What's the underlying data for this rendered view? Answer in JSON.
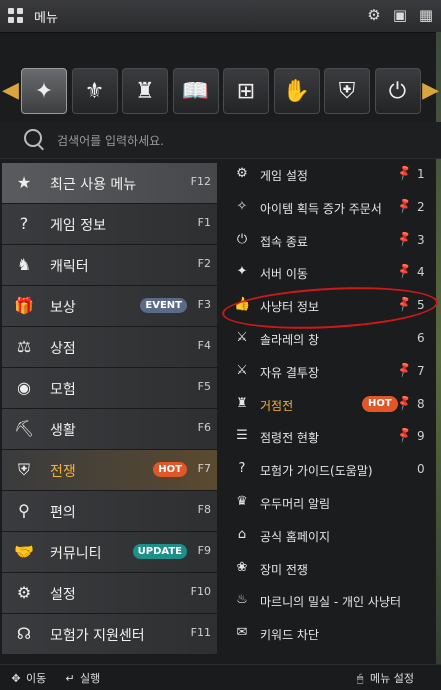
{
  "window": {
    "title": "메뉴"
  },
  "titlebar_icons": [
    "gear-icon",
    "window-icon",
    "grid-icon"
  ],
  "search": {
    "placeholder": "검색어를 입력하세요."
  },
  "categories": [
    {
      "name": "compass-icon",
      "glyph": "✦",
      "active": true
    },
    {
      "name": "eagle-crest-icon",
      "glyph": "⚜",
      "active": false
    },
    {
      "name": "tower-icon",
      "glyph": "♜",
      "active": false
    },
    {
      "name": "book-icon",
      "glyph": "📖",
      "active": false
    },
    {
      "name": "cross-box-icon",
      "glyph": "⊞",
      "active": false
    },
    {
      "name": "hand-wave-icon",
      "glyph": "✋",
      "active": false
    },
    {
      "name": "shield-sword-icon",
      "glyph": "⛨",
      "active": false
    },
    {
      "name": "power-icon",
      "glyph": "⏻",
      "active": false
    }
  ],
  "left_menu": [
    {
      "label": "최근 사용 메뉴",
      "key": "F12",
      "icon": "bookmark-star-icon",
      "glyph": "★",
      "badge": ""
    },
    {
      "label": "게임 정보",
      "key": "F1",
      "icon": "question-icon",
      "glyph": "?",
      "badge": ""
    },
    {
      "label": "캐릭터",
      "key": "F2",
      "icon": "helmet-icon",
      "glyph": "♞",
      "badge": ""
    },
    {
      "label": "보상",
      "key": "F3",
      "icon": "gift-icon",
      "glyph": "🎁",
      "badge": "EVENT"
    },
    {
      "label": "상점",
      "key": "F4",
      "icon": "shop-icon",
      "glyph": "⚖",
      "badge": ""
    },
    {
      "label": "모험",
      "key": "F5",
      "icon": "globe-icon",
      "glyph": "◉",
      "badge": ""
    },
    {
      "label": "생활",
      "key": "F6",
      "icon": "pickaxe-icon",
      "glyph": "⛏",
      "badge": ""
    },
    {
      "label": "전쟁",
      "key": "F7",
      "icon": "war-shield-icon",
      "glyph": "⛨",
      "badge": "HOT"
    },
    {
      "label": "편의",
      "key": "F8",
      "icon": "magnifier-icon",
      "glyph": "⚲",
      "badge": ""
    },
    {
      "label": "커뮤니티",
      "key": "F9",
      "icon": "handshake-icon",
      "glyph": "🤝",
      "badge": "UPDATE"
    },
    {
      "label": "설정",
      "key": "F10",
      "icon": "settings-icon",
      "glyph": "⚙",
      "badge": ""
    },
    {
      "label": "모험가 지원센터",
      "key": "F11",
      "icon": "headset-icon",
      "glyph": "☊",
      "badge": ""
    }
  ],
  "right_menu": [
    {
      "label": "게임 설정",
      "icon": "gear-icon",
      "glyph": "⚙",
      "pinned": true,
      "num": "1",
      "badge": ""
    },
    {
      "label": "아이템 획득 증가 주문서",
      "icon": "scroll-icon",
      "glyph": "✧",
      "pinned": true,
      "num": "2",
      "badge": ""
    },
    {
      "label": "접속 종료",
      "icon": "power-icon",
      "glyph": "⏻",
      "pinned": true,
      "num": "3",
      "badge": ""
    },
    {
      "label": "서버 이동",
      "icon": "compass-icon",
      "glyph": "✦",
      "pinned": true,
      "num": "4",
      "badge": ""
    },
    {
      "label": "사냥터 정보",
      "icon": "thumb-icon",
      "glyph": "👍",
      "pinned": true,
      "num": "5",
      "badge": ""
    },
    {
      "label": "솔라레의 창",
      "icon": "spear-icon",
      "glyph": "⚔",
      "pinned": false,
      "num": "6",
      "badge": ""
    },
    {
      "label": "자유 결투장",
      "icon": "crossed-swords-icon",
      "glyph": "⚔",
      "pinned": true,
      "num": "7",
      "badge": ""
    },
    {
      "label": "거점전",
      "icon": "tower-icon",
      "glyph": "♜",
      "pinned": true,
      "num": "8",
      "badge": "HOT"
    },
    {
      "label": "점령전 현황",
      "icon": "list-icon",
      "glyph": "☰",
      "pinned": true,
      "num": "9",
      "badge": ""
    },
    {
      "label": "모험가 가이드(도움말)",
      "icon": "question-icon",
      "glyph": "?",
      "pinned": false,
      "num": "0",
      "badge": ""
    },
    {
      "label": "우두머리 알림",
      "icon": "dragon-icon",
      "glyph": "♛",
      "pinned": false,
      "num": "",
      "badge": ""
    },
    {
      "label": "공식 홈페이지",
      "icon": "home-icon",
      "glyph": "⌂",
      "pinned": false,
      "num": "",
      "badge": ""
    },
    {
      "label": "장미 전쟁",
      "icon": "rose-icon",
      "glyph": "❀",
      "pinned": false,
      "num": "",
      "badge": ""
    },
    {
      "label": "마르니의 밀실 - 개인 사냥터",
      "icon": "flame-icon",
      "glyph": "♨",
      "pinned": false,
      "num": "",
      "badge": ""
    },
    {
      "label": "키워드 차단",
      "icon": "chat-block-icon",
      "glyph": "✉",
      "pinned": false,
      "num": "",
      "badge": ""
    }
  ],
  "bottom": {
    "move_label": "이동",
    "run_label": "실행",
    "settings_label": "메뉴 설정"
  },
  "colors": {
    "accent": "#e8a923",
    "hot": "#e2572a",
    "event": "#5b6a86",
    "update": "#1f8f8a",
    "annotation": "#d01818"
  }
}
